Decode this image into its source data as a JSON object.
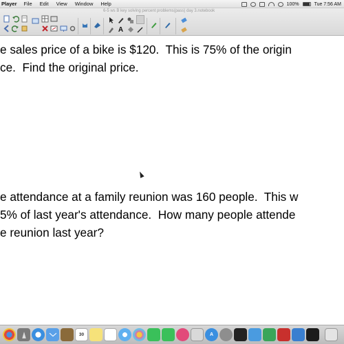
{
  "menubar": {
    "app_name": "Player",
    "menus": [
      "File",
      "Edit",
      "View",
      "Window",
      "Help"
    ],
    "battery": "100%",
    "clock": "Tue 7:56 AM"
  },
  "toolbar": {
    "window_title": "6-5 ws B key solving percent problems(pass) day 3.notebook"
  },
  "document": {
    "problem1": {
      "line1": "e sales price of a bike is $120.  This is 75% of the origin",
      "line2": "ce.  Find the original price."
    },
    "problem2": {
      "line1": "e attendance at a family reunion was 160 people.  This w",
      "line2": "5% of last year's attendance.  How many people attende",
      "line3": "e reunion last year?"
    }
  },
  "dock": {
    "calendar_day": "30"
  },
  "colors": {
    "menubar_bg": "#e8e8e8",
    "toolbar_bg": "#dedede",
    "dock_bg": "#c8c8c8",
    "text": "#000000"
  }
}
